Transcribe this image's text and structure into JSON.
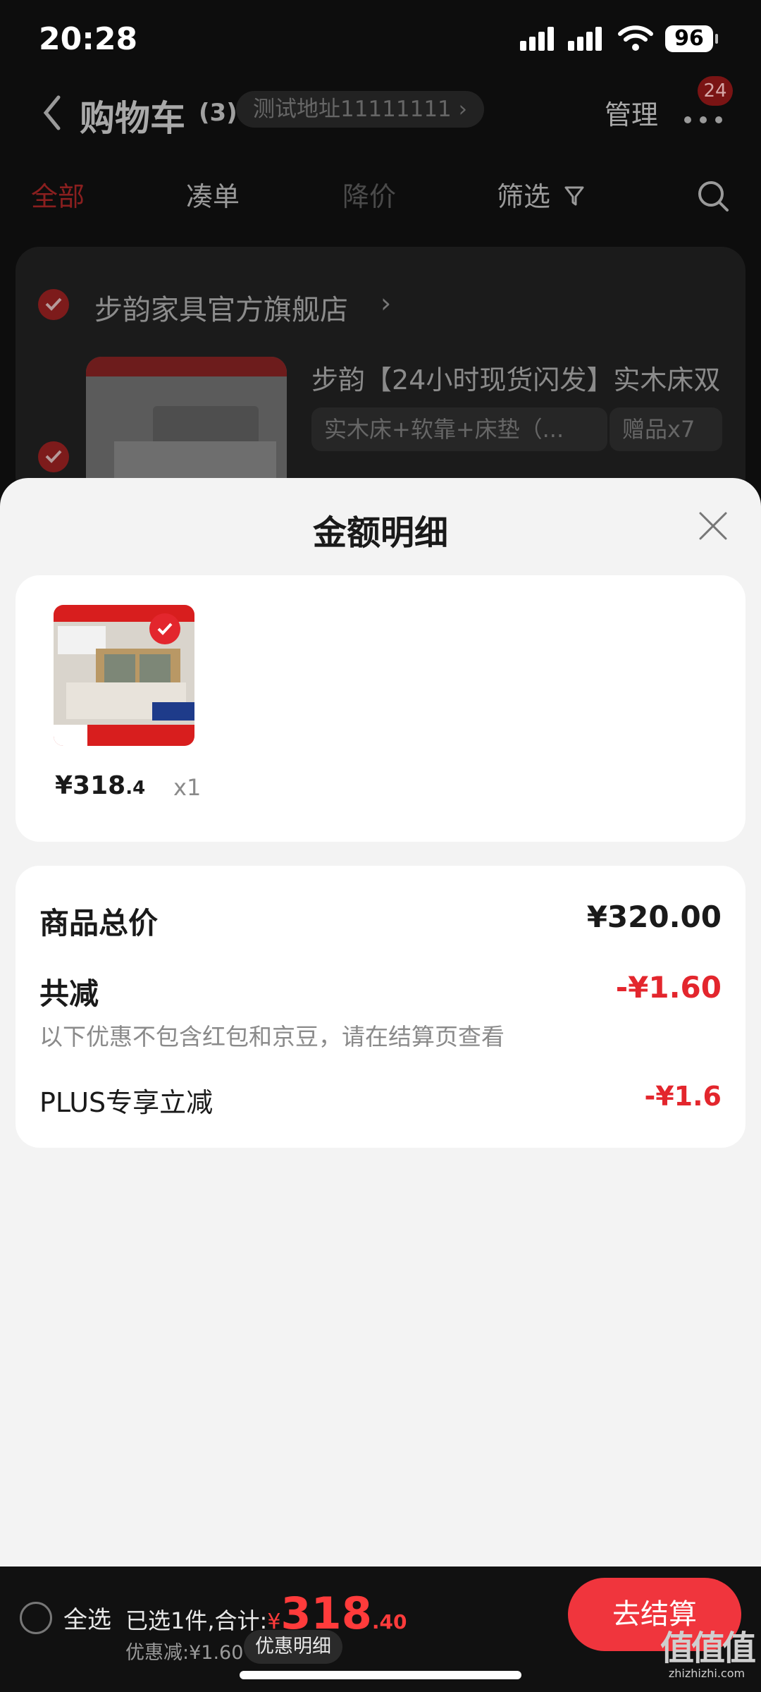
{
  "status_bar": {
    "time": "20:28",
    "battery": "96"
  },
  "header": {
    "title": "购物车",
    "count": "(3)",
    "address": "测试地址11111111 ›",
    "manage": "管理",
    "badge": "24"
  },
  "tabs": [
    {
      "label": "全部"
    },
    {
      "label": "凑单"
    },
    {
      "label": "降价"
    },
    {
      "label": "筛选"
    }
  ],
  "store": {
    "name": "步韵家具官方旗舰店",
    "arrow": "›",
    "product_title": "步韵【24小时现货闪发】实木床双",
    "spec": "实木床+软靠+床垫（...",
    "gift": "赠品x7"
  },
  "sheet": {
    "title": "金额明细",
    "item": {
      "price_int": "¥318",
      "price_dec": ".4",
      "qty": "x1"
    },
    "summary": {
      "total_label": "商品总价",
      "total_value": "¥320.00",
      "reduce_label": "共减",
      "reduce_value": "-¥1.60",
      "note": "以下优惠不包含红包和京豆，请在结算页查看",
      "plus_label": "PLUS专享立减",
      "plus_value": "-¥1.6"
    }
  },
  "bottom_bar": {
    "select_all": "全选",
    "selected_text": "已选1件,合计:",
    "currency": "¥",
    "total_int": "318",
    "total_dec": ".40",
    "discount": "优惠减:¥1.60",
    "detail_button": "优惠明细",
    "checkout": "去结算"
  },
  "watermark": {
    "main": "值值值",
    "sub": "zhizhizhi.com"
  },
  "colors": {
    "accent_red": "#e3262d",
    "checkout": "#f0353d",
    "sheet_bg": "#f3f3f3"
  }
}
